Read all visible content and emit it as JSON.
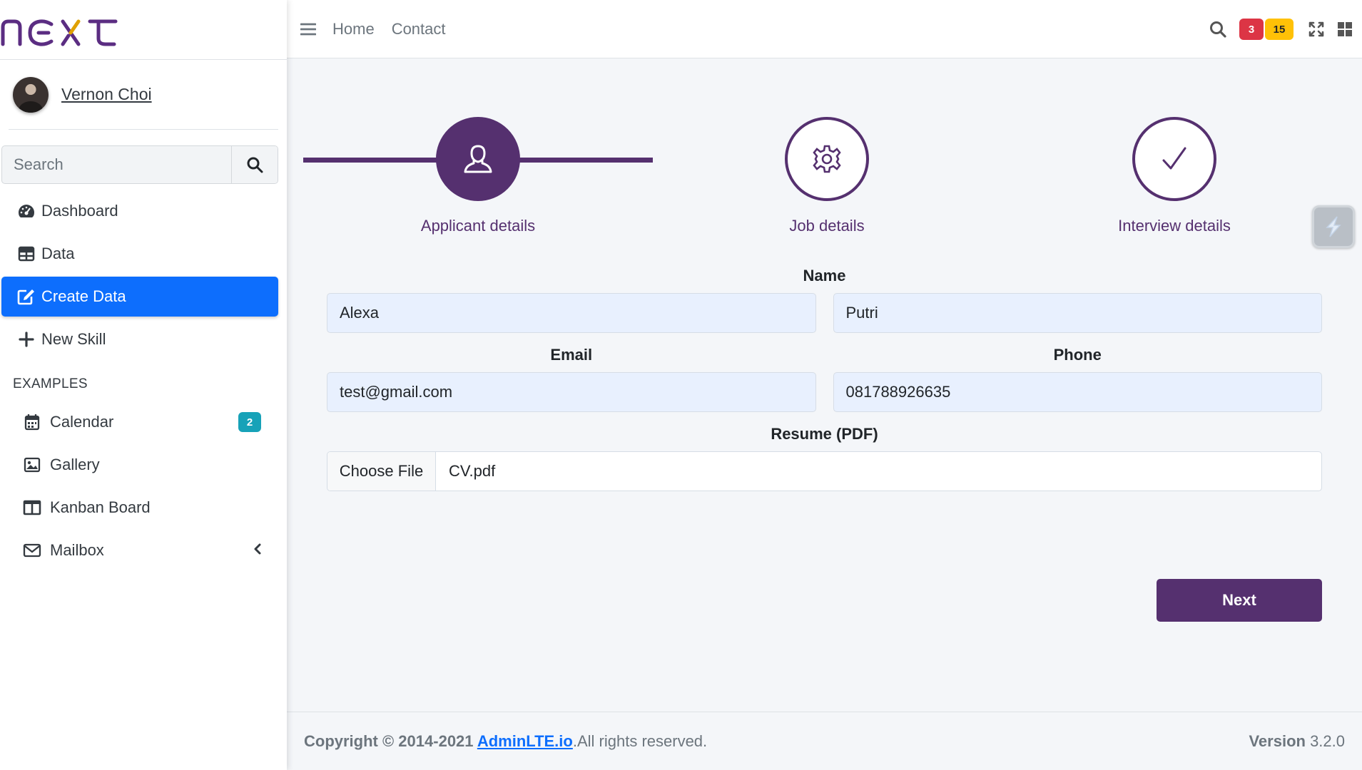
{
  "brand": {
    "logo_text": "next",
    "logo_color": "#5b2d82"
  },
  "user": {
    "name": "Vernon Choi"
  },
  "sidebar": {
    "search": {
      "placeholder": "Search",
      "value": ""
    },
    "items": [
      {
        "label": "Dashboard",
        "icon": "dashboard-gauge-icon"
      },
      {
        "label": "Data",
        "icon": "table-icon"
      },
      {
        "label": "Create Data",
        "icon": "edit-icon",
        "active": true
      },
      {
        "label": "New Skill",
        "icon": "plus-icon"
      }
    ],
    "section_header": "EXAMPLES",
    "examples": [
      {
        "label": "Calendar",
        "icon": "calendar-icon",
        "badge": "2"
      },
      {
        "label": "Gallery",
        "icon": "image-icon"
      },
      {
        "label": "Kanban Board",
        "icon": "columns-icon"
      },
      {
        "label": "Mailbox",
        "icon": "envelope-icon",
        "chevron": "chevron-left-icon"
      }
    ]
  },
  "topbar": {
    "links": [
      "Home",
      "Contact"
    ],
    "badges": {
      "red": "3",
      "yellow": "15"
    }
  },
  "stepper": {
    "steps": [
      {
        "label": "Applicant details",
        "icon": "user-icon",
        "active": true
      },
      {
        "label": "Job details",
        "icon": "gear-icon",
        "active": false
      },
      {
        "label": "Interview details",
        "icon": "check-icon",
        "active": false
      }
    ]
  },
  "form": {
    "name_label": "Name",
    "first_name": "Alexa",
    "last_name": "Putri",
    "email_label": "Email",
    "email": "test@gmail.com",
    "phone_label": "Phone",
    "phone": "081788926635",
    "resume_label": "Resume (PDF)",
    "choose_file": "Choose File",
    "file_name": "CV.pdf",
    "next": "Next"
  },
  "footer": {
    "copyright": "Copyright © 2014-2021 ",
    "link": "AdminLTE.io",
    "rights": ".All rights reserved.",
    "version_label": "Version",
    "version": " 3.2.0"
  },
  "colors": {
    "accent": "#55306f",
    "active_nav": "#0d6efd",
    "badge_red": "#dc3545",
    "badge_yellow": "#ffc107",
    "badge_teal": "#17a2b8",
    "input_bg": "#e8f0fe"
  }
}
